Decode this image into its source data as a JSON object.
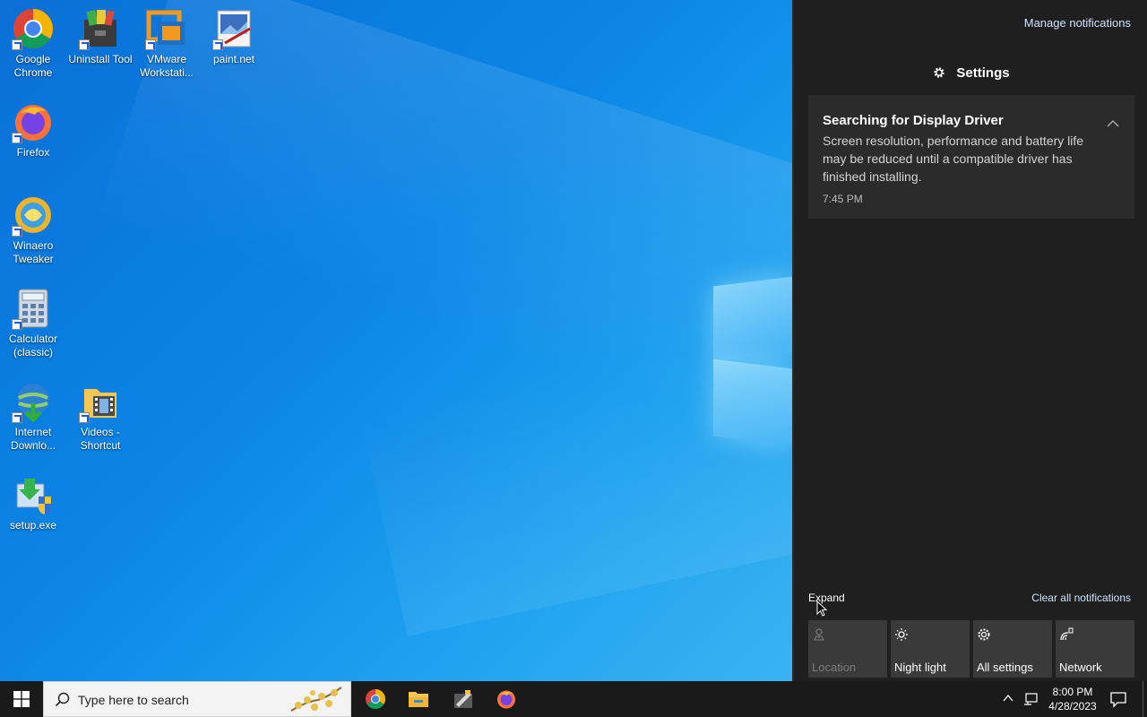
{
  "desktop": {
    "icons": [
      {
        "label": "Google Chrome",
        "icon": "chrome-icon"
      },
      {
        "label": "Uninstall Tool",
        "icon": "uninstall-tool-icon"
      },
      {
        "label": "VMware Workstati...",
        "icon": "vmware-icon"
      },
      {
        "label": "paint.net",
        "icon": "paint-net-icon"
      },
      {
        "label": "Firefox",
        "icon": "firefox-icon"
      },
      {
        "label": "Winaero Tweaker",
        "icon": "winaero-tweaker-icon"
      },
      {
        "label": "Calculator (classic)",
        "icon": "calculator-icon"
      },
      {
        "label": "Internet Downlo...",
        "icon": "internet-download-manager-icon"
      },
      {
        "label": "Videos - Shortcut",
        "icon": "videos-folder-icon"
      },
      {
        "label": "setup.exe",
        "icon": "setup-icon"
      }
    ]
  },
  "action_center": {
    "manage_label": "Manage notifications",
    "group_title": "Settings",
    "notification": {
      "title": "Searching for Display Driver",
      "body": "Screen resolution, performance and battery life may be reduced until a compatible driver has finished installing.",
      "time": "7:45 PM"
    },
    "expand_label": "Expand",
    "clear_label": "Clear all notifications",
    "quick_actions": [
      {
        "label": "Location",
        "icon": "location-icon",
        "enabled": false
      },
      {
        "label": "Night light",
        "icon": "brightness-icon",
        "enabled": true
      },
      {
        "label": "All settings",
        "icon": "gear-icon",
        "enabled": true
      },
      {
        "label": "Network",
        "icon": "network-icon",
        "enabled": true
      }
    ]
  },
  "taskbar": {
    "search_placeholder": "Type here to search",
    "pinned_apps": [
      "chrome-icon",
      "file-explorer-icon",
      "tool-icon",
      "firefox-icon"
    ],
    "clock": {
      "time": "8:00 PM",
      "date": "4/28/2023"
    }
  },
  "colors": {
    "desktop_blue": "#0b86e6",
    "panel_bg": "#1f1f1f",
    "card_bg": "#2b2b2b",
    "tile_bg": "#3a3a3a",
    "taskbar_bg": "#1a1a1a",
    "link_blue": "#cfe3ff"
  }
}
